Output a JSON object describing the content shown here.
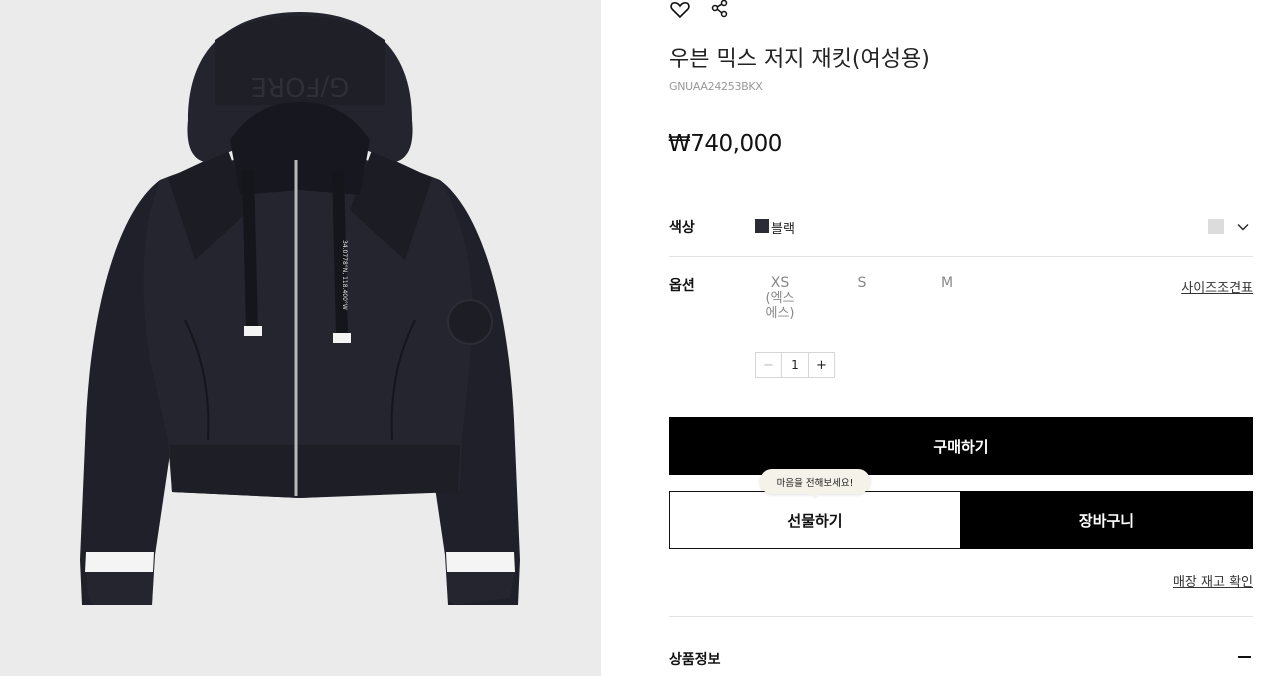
{
  "image": {
    "alt_subject": "jacket-product-photo",
    "chest_text": "34.0778°N, 118.400°W",
    "hood_text": "G/FORE",
    "background": "#ebebeb"
  },
  "icons": {
    "wishlist": "heart-icon",
    "share": "share-icon"
  },
  "product": {
    "title": "우븐 믹스 저지 재킷(여성용)",
    "sku": "GNUAA24253BKX",
    "price": "₩740,000"
  },
  "color": {
    "label": "색상",
    "selected_name": "블랙",
    "selected_hex": "#2a2b35",
    "alt_hex": "#dcdcdc"
  },
  "options": {
    "label": "옵션",
    "sizes": [
      {
        "label": "XS",
        "sub": "(엑스\n에스)"
      },
      {
        "label": "S"
      },
      {
        "label": "M"
      }
    ],
    "size_guide": "사이즈조견표",
    "quantity": {
      "minus": "−",
      "value": "1",
      "plus": "+"
    }
  },
  "actions": {
    "buy": "구매하기",
    "gift": "선물하기",
    "cart": "장바구니",
    "gift_tooltip": "마음을 전해보세요!",
    "stock": "매장 재고 확인"
  },
  "section": {
    "product_info": "상품정보"
  }
}
